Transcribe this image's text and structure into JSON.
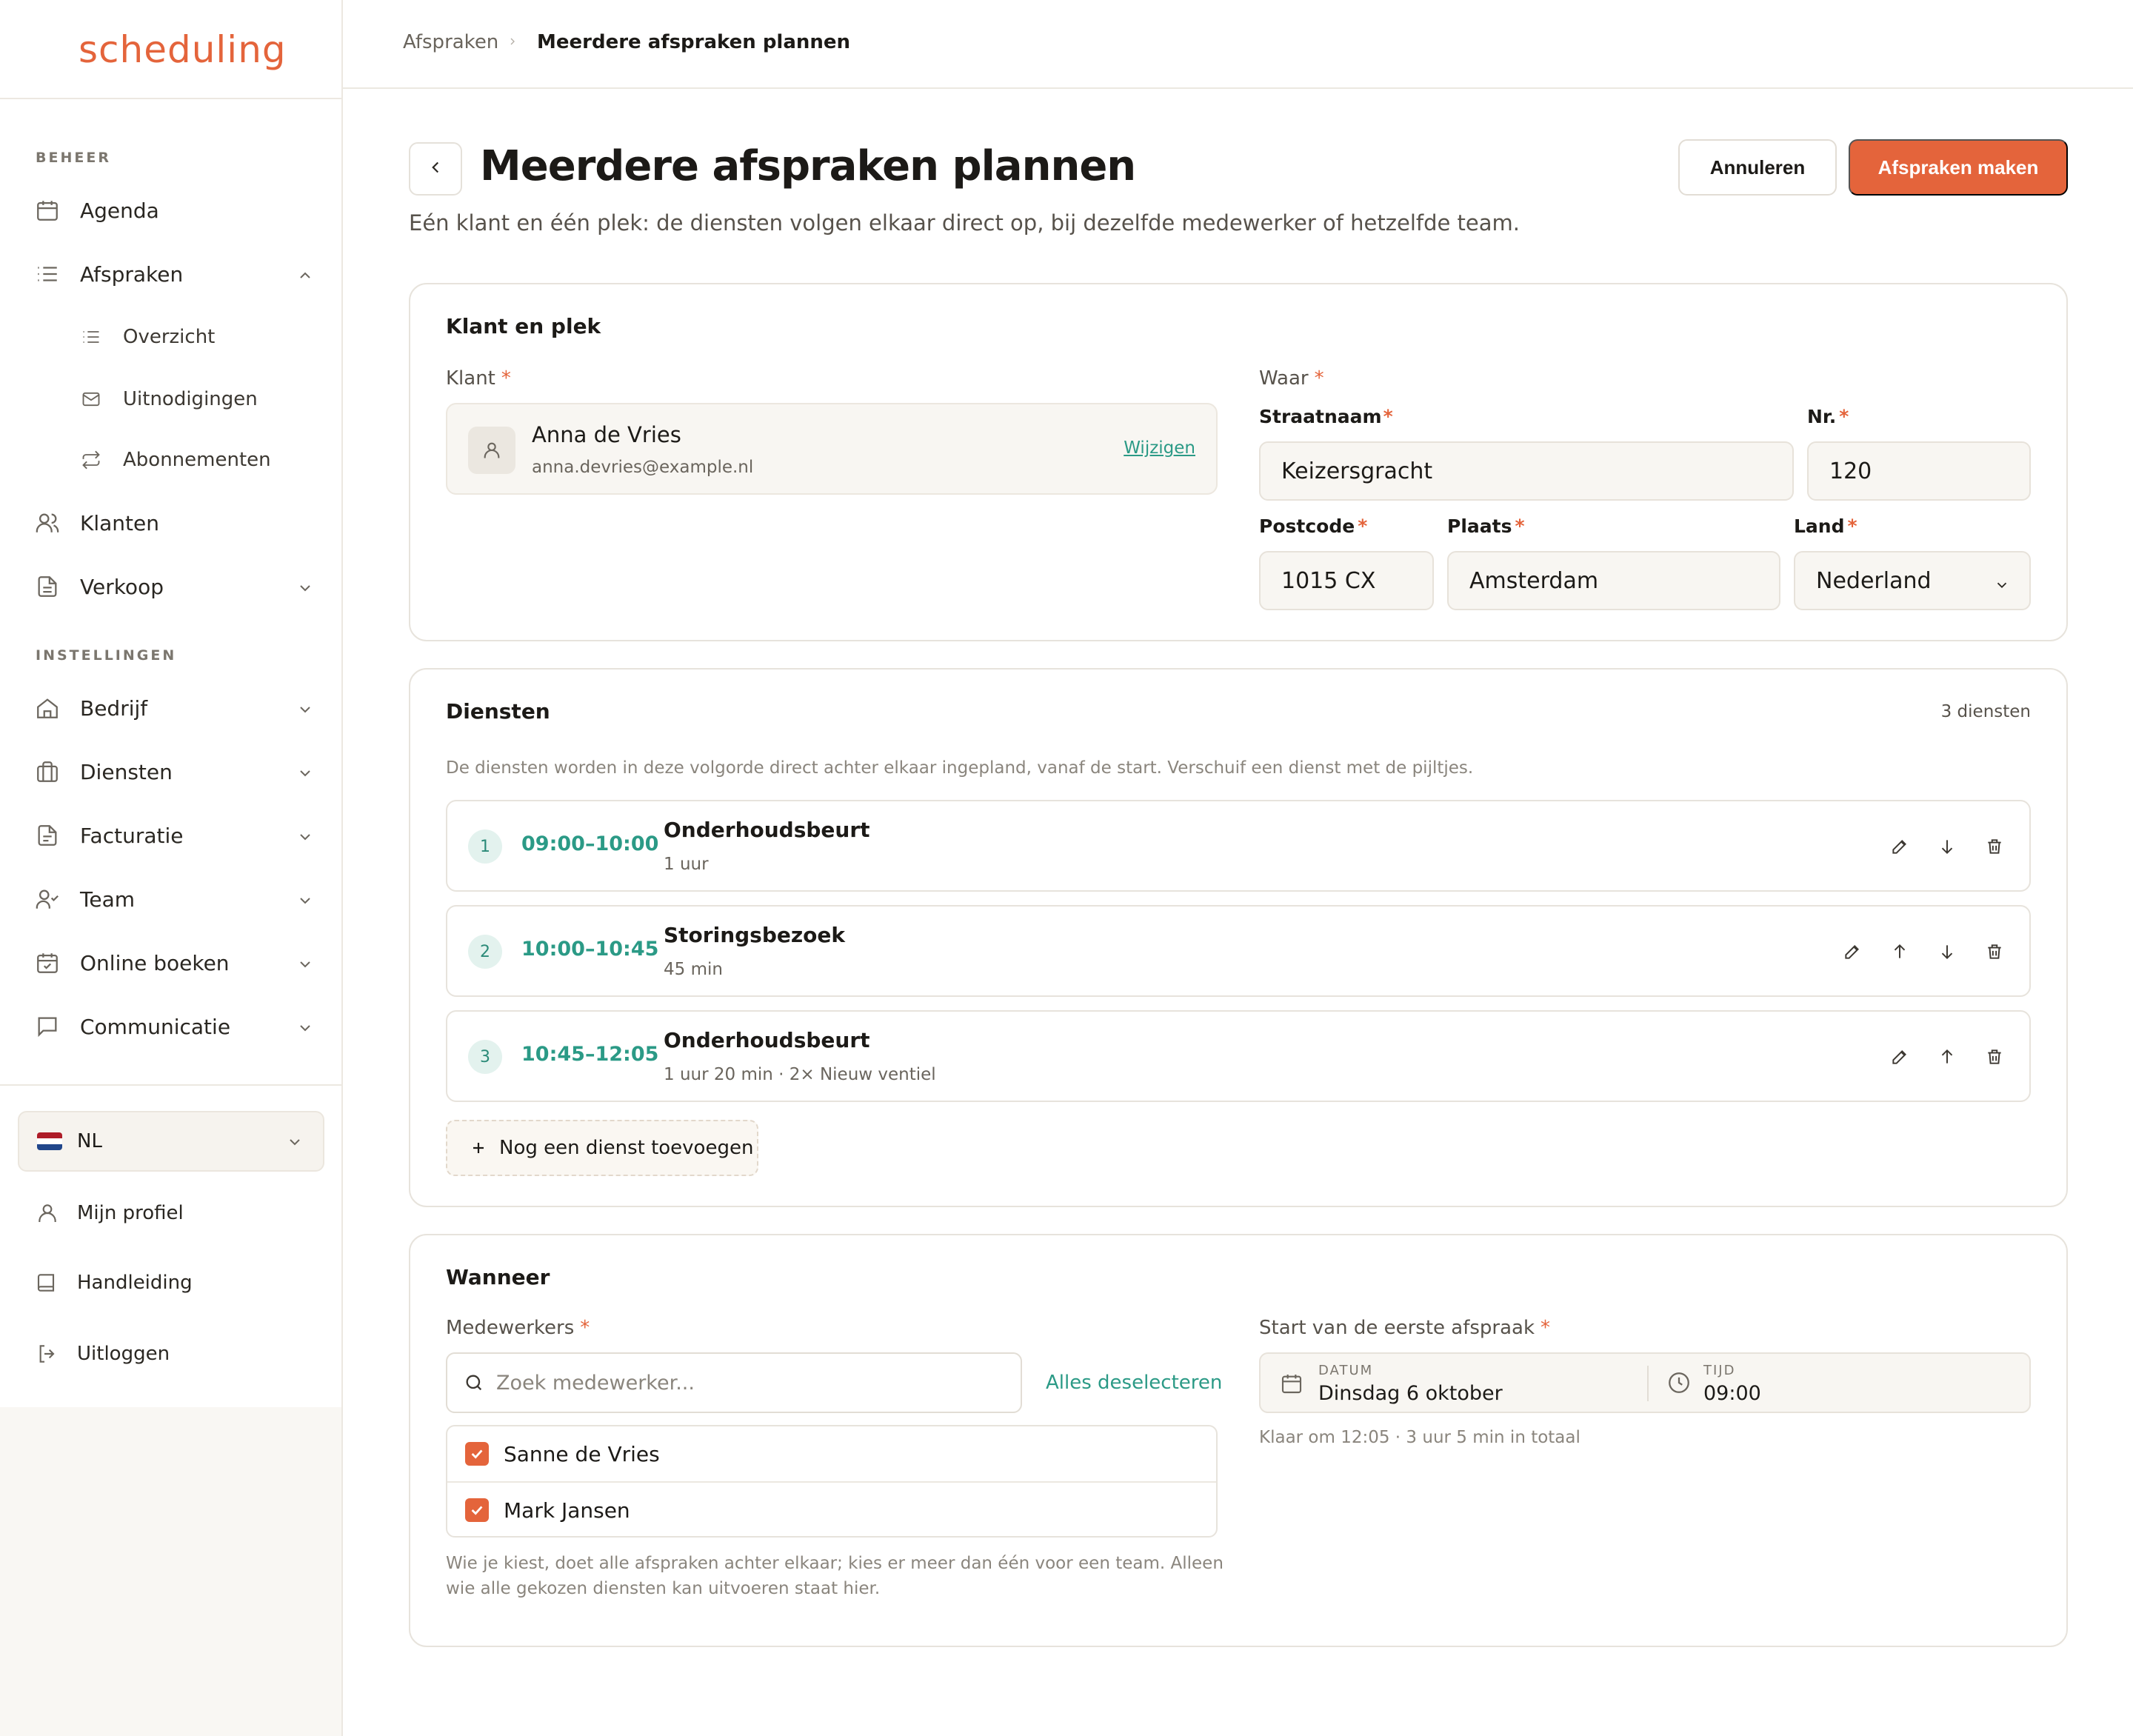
{
  "app": {
    "logo": "scheduling"
  },
  "sidebar": {
    "section_beheer": "BEHEER",
    "section_instellingen": "INSTELLINGEN",
    "items": {
      "agenda": "Agenda",
      "afspraken": "Afspraken",
      "overzicht": "Overzicht",
      "uitnodigingen": "Uitnodigingen",
      "abonnementen": "Abonnementen",
      "klanten": "Klanten",
      "verkoop": "Verkoop",
      "bedrijf": "Bedrijf",
      "diensten": "Diensten",
      "facturatie": "Facturatie",
      "team": "Team",
      "online_boeken": "Online boeken",
      "communicatie": "Communicatie"
    },
    "language": "NL",
    "footer": {
      "profiel": "Mijn profiel",
      "handleiding": "Handleiding",
      "uitloggen": "Uitloggen"
    }
  },
  "breadcrumb": {
    "parent": "Afspraken",
    "current": "Meerdere afspraken plannen"
  },
  "header": {
    "title": "Meerdere afspraken plannen",
    "subtitle": "Eén klant en één plek: de diensten volgen elkaar direct op, bij dezelfde medewerker of hetzelfde team.",
    "cancel": "Annuleren",
    "submit": "Afspraken maken"
  },
  "klant_card": {
    "title": "Klant en plek",
    "klant_label": "Klant",
    "client_name": "Anna de Vries",
    "client_email": "anna.devries@example.nl",
    "change_link": "Wijzigen",
    "waar_label": "Waar",
    "straat_label": "Straatnaam",
    "straat_value": "Keizersgracht",
    "nr_label": "Nr.",
    "nr_value": "120",
    "postcode_label": "Postcode",
    "postcode_value": "1015 CX",
    "plaats_label": "Plaats",
    "plaats_value": "Amsterdam",
    "land_label": "Land",
    "land_value": "Nederland",
    "required_mark": "*"
  },
  "diensten_card": {
    "title": "Diensten",
    "count": "3 diensten",
    "description": "De diensten worden in deze volgorde direct achter elkaar ingepland, vanaf de start. Verschuif een dienst met de pijltjes.",
    "services": [
      {
        "num": "1",
        "time": "09:00–10:00",
        "name": "Onderhoudsbeurt",
        "meta": "1 uur"
      },
      {
        "num": "2",
        "time": "10:00–10:45",
        "name": "Storingsbezoek",
        "meta": "45 min"
      },
      {
        "num": "3",
        "time": "10:45–12:05",
        "name": "Onderhoudsbeurt",
        "meta": "1 uur 20 min · 2× Nieuw ventiel"
      }
    ],
    "add_label": "Nog een dienst toevoegen"
  },
  "wanneer_card": {
    "title": "Wanneer",
    "medewerkers_label": "Medewerkers",
    "search_placeholder": "Zoek medewerker...",
    "deselect_link": "Alles deselecteren",
    "employees": [
      "Sanne de Vries",
      "Mark Jansen"
    ],
    "help_text": "Wie je kiest, doet alle afspraken achter elkaar; kies er meer dan één voor een team. Alleen wie alle gekozen diensten kan uitvoeren staat hier.",
    "start_label": "Start van de eerste afspraak",
    "datum_label": "DATUM",
    "datum_value": "Dinsdag 6 oktober",
    "tijd_label": "TIJD",
    "tijd_value": "09:00",
    "summary": "Klaar om 12:05 · 3 uur 5 min in totaal"
  },
  "colors": {
    "accent": "#e4643b",
    "teal": "#2b9a86"
  }
}
